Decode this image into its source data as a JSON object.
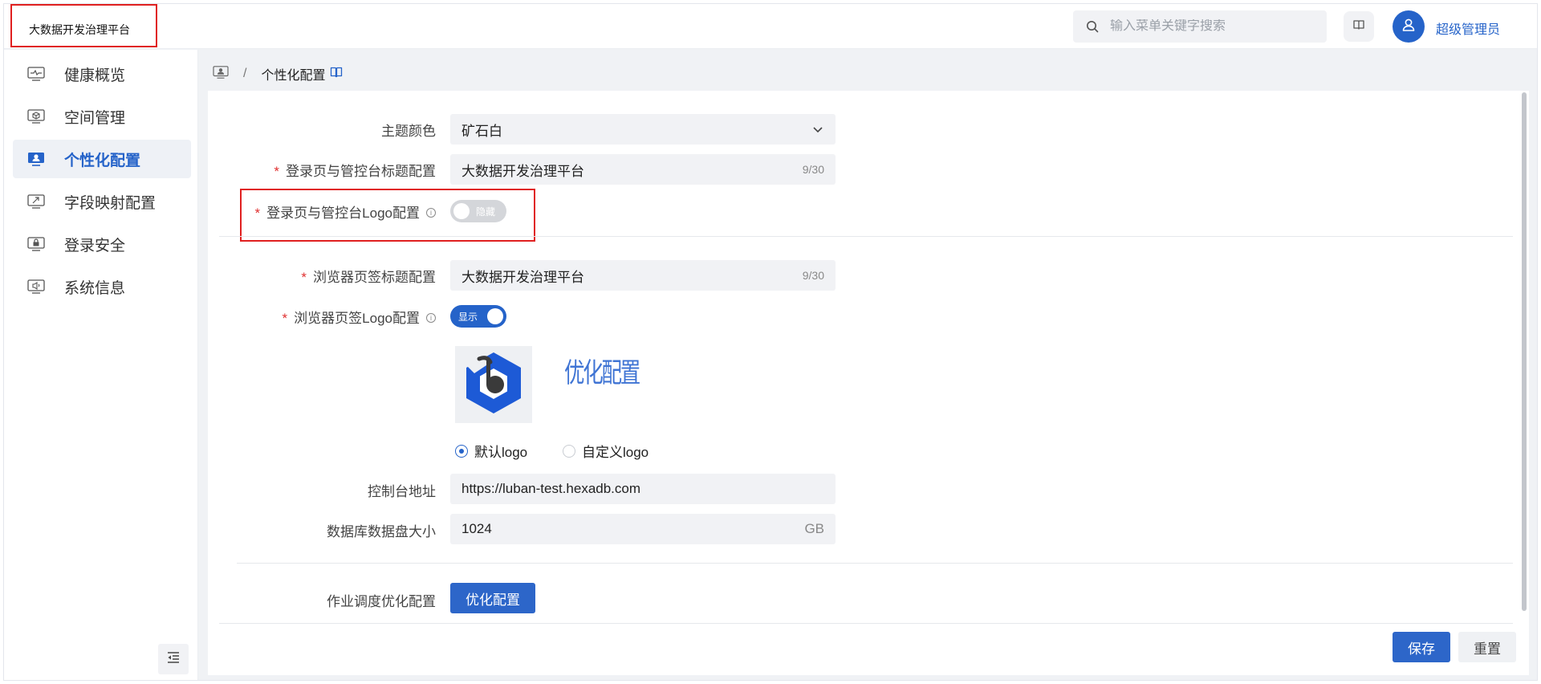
{
  "header": {
    "brand": "大数据开发治理平台",
    "search_placeholder": "输入菜单关键字搜索",
    "username": "超级管理员"
  },
  "sidebar": {
    "items": [
      {
        "label": "健康概览",
        "icon": "pulse-monitor-icon"
      },
      {
        "label": "空间管理",
        "icon": "cube-monitor-icon"
      },
      {
        "label": "个性化配置",
        "icon": "personalize-monitor-icon",
        "active": true
      },
      {
        "label": "字段映射配置",
        "icon": "mapping-monitor-icon"
      },
      {
        "label": "登录安全",
        "icon": "lock-monitor-icon"
      },
      {
        "label": "系统信息",
        "icon": "speaker-monitor-icon"
      }
    ]
  },
  "breadcrumb": {
    "separator": "/",
    "current": "个性化配置"
  },
  "form": {
    "theme_color": {
      "label": "主题颜色",
      "value": "矿石白"
    },
    "login_title": {
      "label": "登录页与管控台标题配置",
      "value": "大数据开发治理平台",
      "count": "9/30"
    },
    "login_logo": {
      "label": "登录页与管控台Logo配置",
      "switch_text": "隐藏",
      "switch_on": false
    },
    "tab_title": {
      "label": "浏览器页签标题配置",
      "value": "大数据开发治理平台",
      "count": "9/30"
    },
    "tab_logo": {
      "label": "浏览器页签Logo配置",
      "switch_text": "显示",
      "switch_on": true
    },
    "logo_preview_text": "优化配置",
    "logo_options": [
      "默认logo",
      "自定义logo"
    ],
    "logo_selected": "默认logo",
    "console_url": {
      "label": "控制台地址",
      "value": "https://luban-test.hexadb.com"
    },
    "disk_size": {
      "label": "数据库数据盘大小",
      "value": "1024",
      "unit": "GB"
    },
    "job_schedule": {
      "label": "作业调度优化配置",
      "button": "优化配置"
    }
  },
  "footer": {
    "save": "保存",
    "reset": "重置"
  },
  "colors": {
    "accent": "#2563c9",
    "highlight": "#e02020"
  }
}
